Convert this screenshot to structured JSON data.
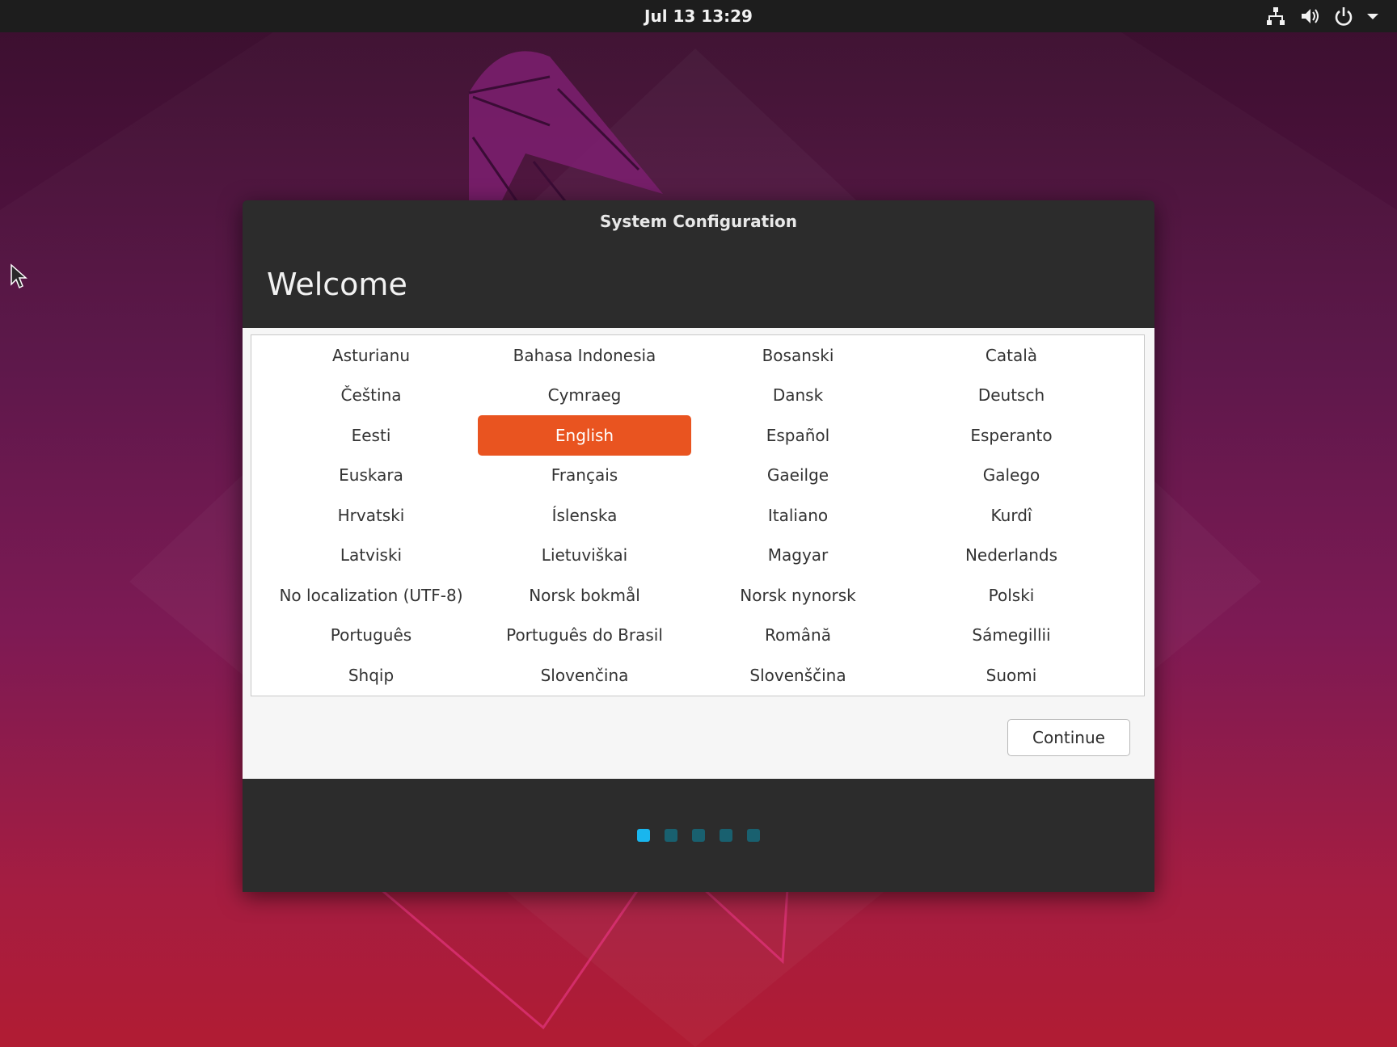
{
  "topbar": {
    "clock": "Jul 13  13:29",
    "icons": [
      "network-icon",
      "volume-icon",
      "power-icon",
      "chevron-down-icon"
    ]
  },
  "dialog": {
    "title": "System Configuration",
    "heading": "Welcome",
    "languages": [
      "Asturianu",
      "Bahasa Indonesia",
      "Bosanski",
      "Català",
      "Čeština",
      "Cymraeg",
      "Dansk",
      "Deutsch",
      "Eesti",
      "English",
      "Español",
      "Esperanto",
      "Euskara",
      "Français",
      "Gaeilge",
      "Galego",
      "Hrvatski",
      "Íslenska",
      "Italiano",
      "Kurdî",
      "Latviski",
      "Lietuviškai",
      "Magyar",
      "Nederlands",
      "No localization (UTF-8)",
      "Norsk bokmål",
      "Norsk nynorsk",
      "Polski",
      "Português",
      "Português do Brasil",
      "Română",
      "Sámegillii",
      "Shqip",
      "Slovenčina",
      "Slovenščina",
      "Suomi"
    ],
    "selected_language": "English",
    "continue_label": "Continue",
    "pager": {
      "total_pages": 5,
      "current_page": 1
    }
  },
  "colors": {
    "accent": "#e95420",
    "pager_active": "#19b6ee",
    "pager_inactive": "#19606f"
  }
}
